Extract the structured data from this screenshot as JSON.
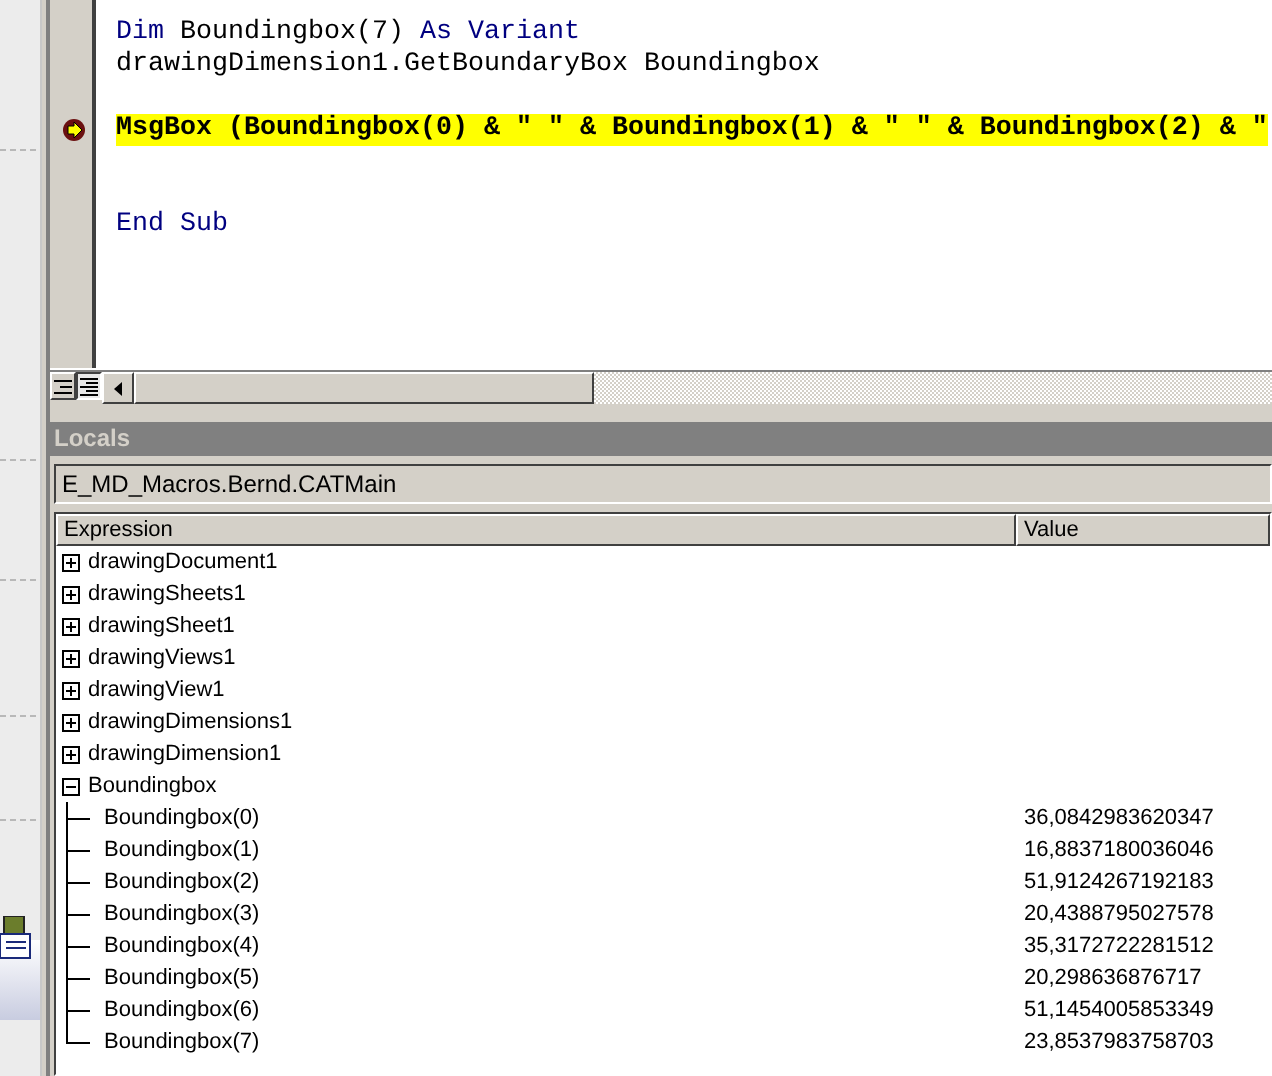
{
  "code_lines": [
    {
      "kind": "code",
      "current": false,
      "tokens": [
        {
          "text": "Dim ",
          "kind": "keyword"
        },
        {
          "text": "Boundingbox(7) ",
          "kind": "plain"
        },
        {
          "text": "As Variant",
          "kind": "keyword"
        }
      ]
    },
    {
      "kind": "code",
      "current": false,
      "tokens": [
        {
          "text": "drawingDimension1.GetBoundaryBox Boundingbox",
          "kind": "plain"
        }
      ]
    },
    {
      "kind": "blank"
    },
    {
      "kind": "code",
      "current": true,
      "tokens": [
        {
          "text": "MsgBox (Boundingbox(0) & \" \" & Boundingbox(1) & \" \" & Boundingbox(2) & \"",
          "kind": "plain"
        }
      ]
    },
    {
      "kind": "blank"
    },
    {
      "kind": "blank"
    },
    {
      "kind": "code",
      "current": false,
      "tokens": [
        {
          "text": "End Sub",
          "kind": "keyword"
        }
      ]
    }
  ],
  "locals": {
    "title": "Locals",
    "context": "E_MD_Macros.Bernd.CATMain",
    "columns": [
      "Expression",
      "Value"
    ],
    "rows": [
      {
        "expression": "drawingDocument1",
        "expanded": false
      },
      {
        "expression": "drawingSheets1",
        "expanded": false
      },
      {
        "expression": "drawingSheet1",
        "expanded": false
      },
      {
        "expression": "drawingViews1",
        "expanded": false
      },
      {
        "expression": "drawingView1",
        "expanded": false
      },
      {
        "expression": "drawingDimensions1",
        "expanded": false
      },
      {
        "expression": "drawingDimension1",
        "expanded": false
      },
      {
        "expression": "Boundingbox",
        "expanded": true,
        "children": [
          {
            "expression": "Boundingbox(0)",
            "value": "36,0842983620347"
          },
          {
            "expression": "Boundingbox(1)",
            "value": "16,8837180036046"
          },
          {
            "expression": "Boundingbox(2)",
            "value": "51,9124267192183"
          },
          {
            "expression": "Boundingbox(3)",
            "value": "20,4388795027578"
          },
          {
            "expression": "Boundingbox(4)",
            "value": "35,3172722281512"
          },
          {
            "expression": "Boundingbox(5)",
            "value": "20,298636876717"
          },
          {
            "expression": "Boundingbox(6)",
            "value": "51,1454005853349"
          },
          {
            "expression": "Boundingbox(7)",
            "value": "23,8537983758703"
          }
        ]
      }
    ]
  }
}
